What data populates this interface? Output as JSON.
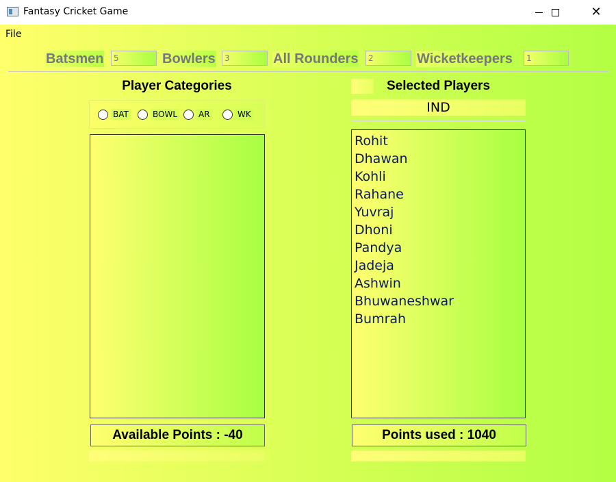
{
  "window": {
    "title": "Fantasy Cricket Game"
  },
  "menu": {
    "file_label": "File"
  },
  "counts": {
    "batsmen_label": "Batsmen",
    "batsmen_value": "5",
    "bowlers_label": "Bowlers",
    "bowlers_value": "3",
    "allrounders_label": "All Rounders",
    "allrounders_value": "2",
    "wicketkeepers_label": "Wicketkeepers",
    "wicketkeepers_value": "1"
  },
  "categories": {
    "heading": "Player Categories",
    "options": [
      "BAT",
      "BOWL",
      "AR",
      "WK"
    ],
    "available_points": "Available Points : -40"
  },
  "selected": {
    "heading": "Selected Players",
    "team_name": "IND",
    "players": [
      "Rohit",
      "Dhawan",
      "Kohli",
      "Rahane",
      "Yuvraj",
      "Dhoni",
      "Pandya",
      "Jadeja",
      "Ashwin",
      "Bhuwaneshwar",
      "Bumrah"
    ],
    "points_used": "Points used : 1040"
  },
  "colors": {
    "gradient_start": "#ffff6a",
    "gradient_end": "#b2ff44",
    "player_text": "#0a1a5c"
  }
}
